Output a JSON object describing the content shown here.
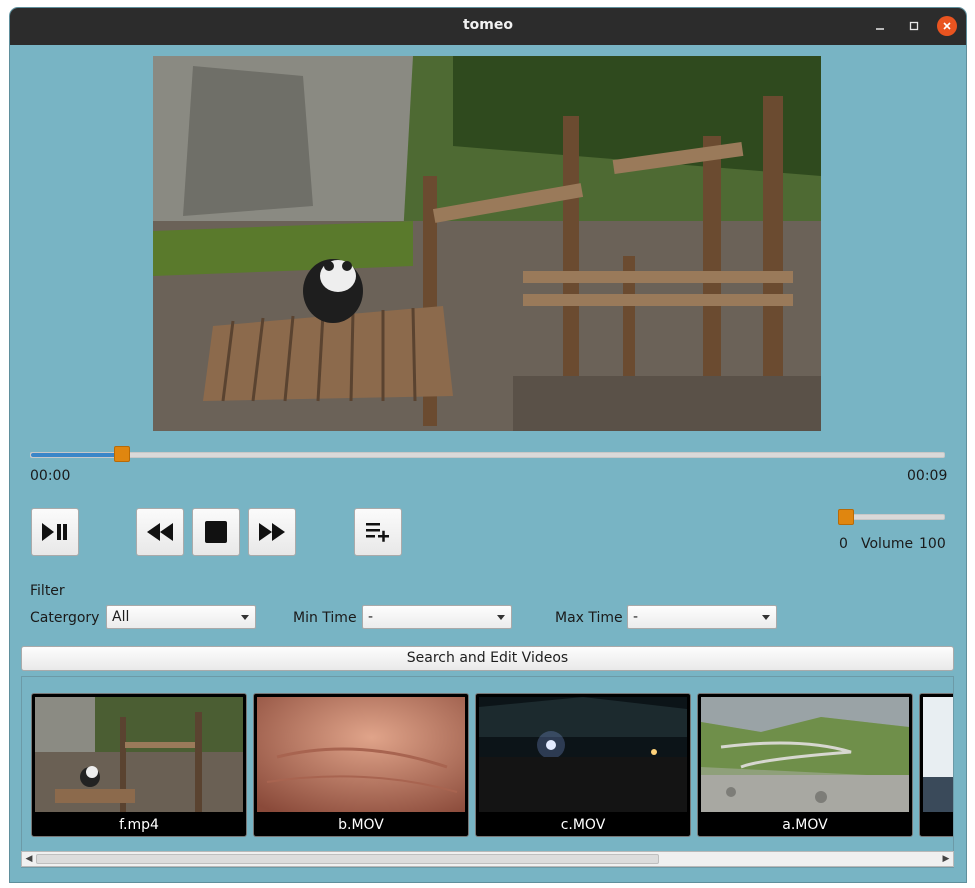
{
  "window": {
    "title": "tomeo"
  },
  "player": {
    "current_time": "00:00",
    "total_time": "00:09",
    "progress": 0.1,
    "volume_min": "0",
    "volume_label": "Volume",
    "volume_max": "100",
    "volume_level": 0.05
  },
  "filter": {
    "heading": "Filter",
    "category_label": "Catergory",
    "category_value": "All",
    "min_time_label": "Min Time",
    "min_time_value": "-",
    "max_time_label": "Max Time",
    "max_time_value": "-"
  },
  "search_button": "Search and Edit Videos",
  "videos": [
    {
      "name": "f.mp4"
    },
    {
      "name": "b.MOV"
    },
    {
      "name": "c.MOV"
    },
    {
      "name": "a.MOV"
    }
  ],
  "icons": [
    "play-pause-icon",
    "rewind-icon",
    "stop-icon",
    "fast-forward-icon",
    "playlist-add-icon"
  ],
  "colors": {
    "accent": "#e0860f",
    "progress": "#3b86c8",
    "background": "#78b4c4",
    "titlebar": "#2c2c2c",
    "close": "#e95420"
  }
}
